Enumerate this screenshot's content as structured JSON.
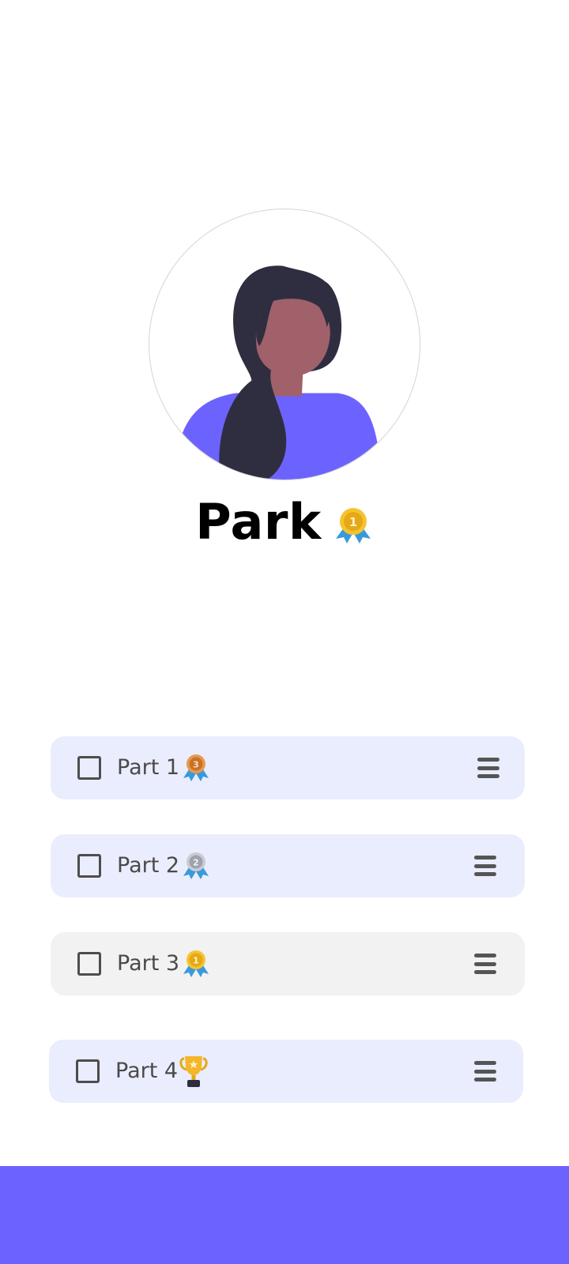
{
  "profile": {
    "name": "Park",
    "name_badge": "gold-medal-icon",
    "avatar": "female-avatar-illustration"
  },
  "parts": [
    {
      "label": "Part 1",
      "badge": "bronze-medal-icon",
      "checked": false,
      "bg": "#eaedfd"
    },
    {
      "label": "Part 2",
      "badge": "silver-medal-icon",
      "checked": false,
      "bg": "#eaedfd"
    },
    {
      "label": "Part 3",
      "badge": "gold-medal-icon",
      "checked": false,
      "bg": "#f2f2f2"
    },
    {
      "label": "Part 4",
      "badge": "trophy-icon",
      "checked": false,
      "bg": "#eaedfd"
    }
  ],
  "colors": {
    "accent": "#6c63ff",
    "card_light": "#eaedfd",
    "card_gray": "#f2f2f2",
    "text": "#4a4a4a"
  }
}
